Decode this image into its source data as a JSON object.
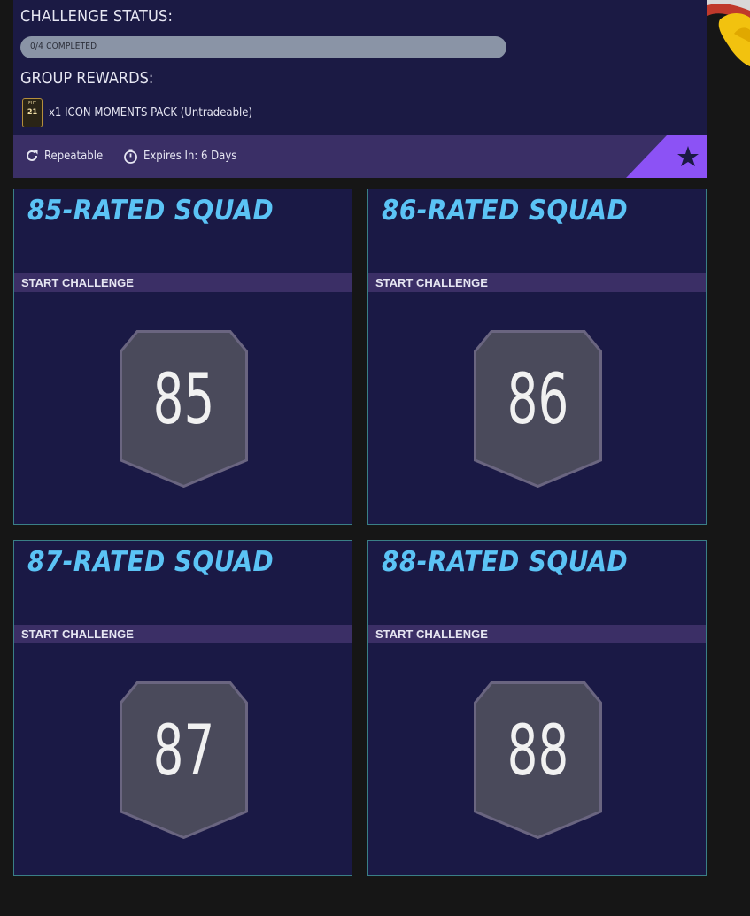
{
  "challenge": {
    "status_label": "CHALLENGE STATUS:",
    "progress_text": "0/4 COMPLETED",
    "progress_fraction": 0,
    "rewards_label": "GROUP REWARDS:",
    "reward_text": "x1 ICON MOMENTS PACK (Untradeable)",
    "pack_icon": {
      "brand": "FUT",
      "number": "21"
    }
  },
  "info_bar": {
    "repeatable_label": "Repeatable",
    "expires_label": "Expires In: 6 Days"
  },
  "colors": {
    "panel_bg": "#1b1a44",
    "accent_purple": "#8c52f5",
    "title_blue": "#5bc3f5",
    "card_border": "#3a7f86"
  },
  "cards": [
    {
      "title": "85-RATED SQUAD",
      "cta": "START CHALLENGE",
      "rating": "85"
    },
    {
      "title": "86-RATED SQUAD",
      "cta": "START CHALLENGE",
      "rating": "86"
    },
    {
      "title": "87-RATED SQUAD",
      "cta": "START CHALLENGE",
      "rating": "87"
    },
    {
      "title": "88-RATED SQUAD",
      "cta": "START CHALLENGE",
      "rating": "88"
    }
  ]
}
